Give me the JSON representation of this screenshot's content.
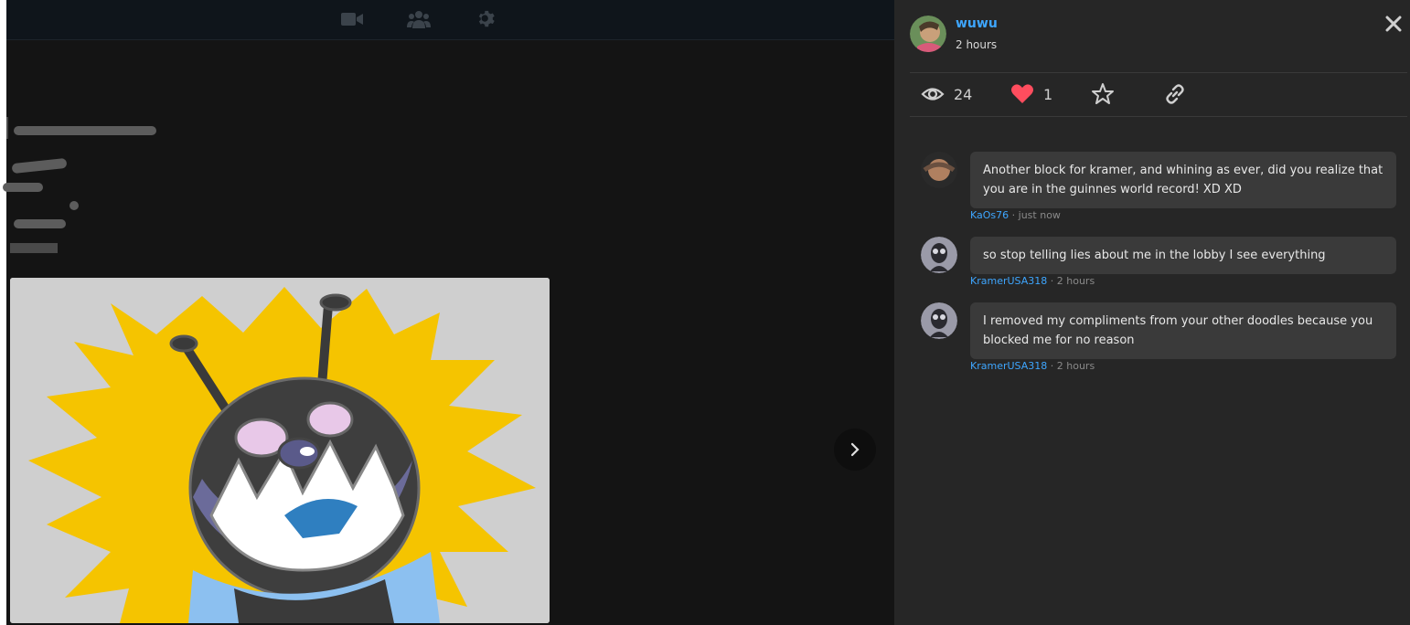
{
  "toolbar": {
    "icons": [
      "video-camera-icon",
      "users-icon",
      "gear-icon"
    ]
  },
  "post": {
    "author": "wuwu",
    "time": "2 hours",
    "views": "24",
    "likes": "1"
  },
  "comments": [
    {
      "text": "Another block for kramer, and whining as ever, did you realize that you are in the guinnes world record! XD XD",
      "user": "KaOs76",
      "time": "just now"
    },
    {
      "text": "so stop telling lies about me in the lobby I see everything",
      "user": "KramerUSA318",
      "time": "2 hours"
    },
    {
      "text": "I removed my compliments from your other doodles because you blocked me for no reason",
      "user": "KramerUSA318",
      "time": "2 hours"
    }
  ],
  "colors": {
    "accent": "#3ea6ff",
    "like": "#ff4d5e",
    "panel": "#262626",
    "bubble": "#3a3a3a"
  }
}
